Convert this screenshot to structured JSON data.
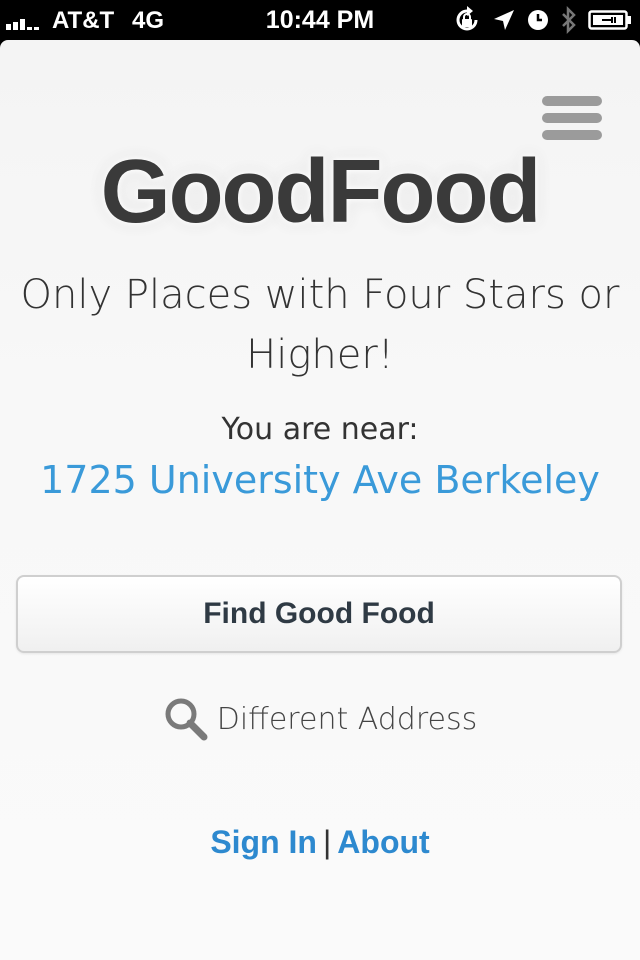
{
  "status_bar": {
    "carrier": "AT&T",
    "network": "4G",
    "time": "10:44 PM",
    "icons": [
      "signal-bars-icon",
      "orientation-lock-icon",
      "location-arrow-icon",
      "alarm-clock-icon",
      "bluetooth-icon",
      "battery-icon"
    ]
  },
  "header": {
    "menu_icon": "hamburger-menu-icon",
    "app_name": "GoodFood"
  },
  "main": {
    "tagline": "Only Places with Four Stars or Higher!",
    "near_label": "You are near:",
    "address": "1725 University Ave Berkeley",
    "find_button_label": "Find Good Food",
    "different_address_label": "Different Address",
    "different_address_icon": "search-icon"
  },
  "footer": {
    "sign_in_label": "Sign In",
    "separator": "|",
    "about_label": "About"
  },
  "colors": {
    "link_blue": "#3a9ad9",
    "footer_link_blue": "#2d89cf",
    "menu_gray": "#9b9b9b",
    "text_dark": "#333333"
  }
}
